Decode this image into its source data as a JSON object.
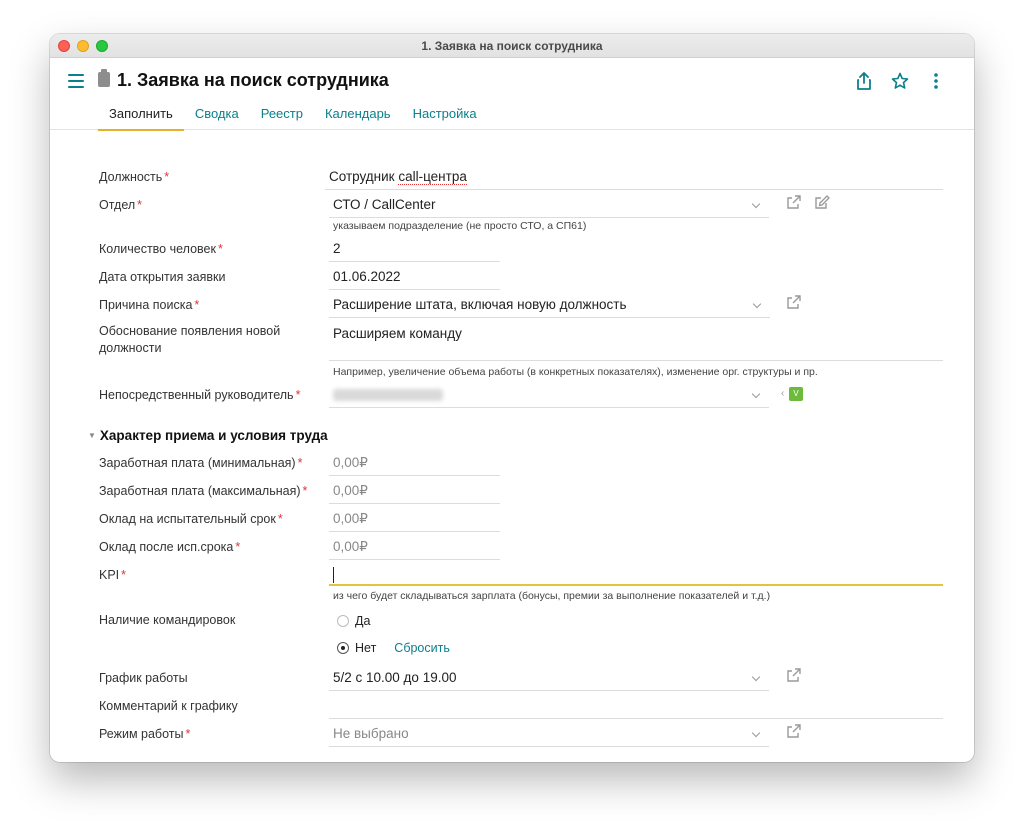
{
  "window": {
    "title": "1. Заявка на поиск сотрудника"
  },
  "header": {
    "title": "1. Заявка на поиск сотрудника",
    "tabs": [
      {
        "label": "Заполнить",
        "active": true
      },
      {
        "label": "Сводка"
      },
      {
        "label": "Реестр"
      },
      {
        "label": "Календарь"
      },
      {
        "label": "Настройка"
      }
    ]
  },
  "form": {
    "position": {
      "label": "Должность",
      "value": "Сотрудник call-центра",
      "value_main": "Сотрудник ",
      "value_spell": "call-центра"
    },
    "department": {
      "label": "Отдел",
      "value": "СТО / CallCenter",
      "hint": "указываем подразделение (не просто СТО, а СП61)"
    },
    "headcount": {
      "label": "Количество человек",
      "value": "2"
    },
    "open_date": {
      "label": "Дата открытия заявки",
      "value": "01.06.2022"
    },
    "search_reason": {
      "label": "Причина поиска",
      "value": "Расширение штата, включая новую должность"
    },
    "justification": {
      "label": "Обоснование появления новой должности",
      "value": "Расширяем команду",
      "hint": "Например, увеличение объема работы (в конкретных показателях), изменение орг. структуры и пр."
    },
    "manager": {
      "label": "Непосредственный руководитель",
      "badge": "V"
    },
    "section": {
      "title": "Характер приема и условия труда"
    },
    "salary_min": {
      "label": "Заработная плата (минимальная)",
      "placeholder": "0,00₽"
    },
    "salary_max": {
      "label": "Заработная плата (максимальная)",
      "placeholder": "0,00₽"
    },
    "probation_salary": {
      "label": "Оклад на испытательный срок",
      "placeholder": "0,00₽"
    },
    "after_probation_salary": {
      "label": "Оклад после исп.срока",
      "placeholder": "0,00₽"
    },
    "kpi": {
      "label": "KPI",
      "hint": "из чего будет складываться зарплата (бонусы, премии за выполнение показателей и т.д.)"
    },
    "business_trips": {
      "label": "Наличие командировок",
      "options": [
        {
          "label": "Да",
          "selected": false
        },
        {
          "label": "Нет",
          "selected": true
        }
      ],
      "reset_label": "Сбросить"
    },
    "schedule": {
      "label": "График работы",
      "value": "5/2 с 10.00 до 19.00"
    },
    "schedule_comment": {
      "label": "Комментарий к графику"
    },
    "work_mode": {
      "label": "Режим работы",
      "placeholder": "Не выбрано"
    }
  },
  "colors": {
    "accent": "#0b7f8a",
    "tab_underline": "#e5b12b",
    "required": "#d43a3a",
    "focus": "#e5c33c"
  }
}
